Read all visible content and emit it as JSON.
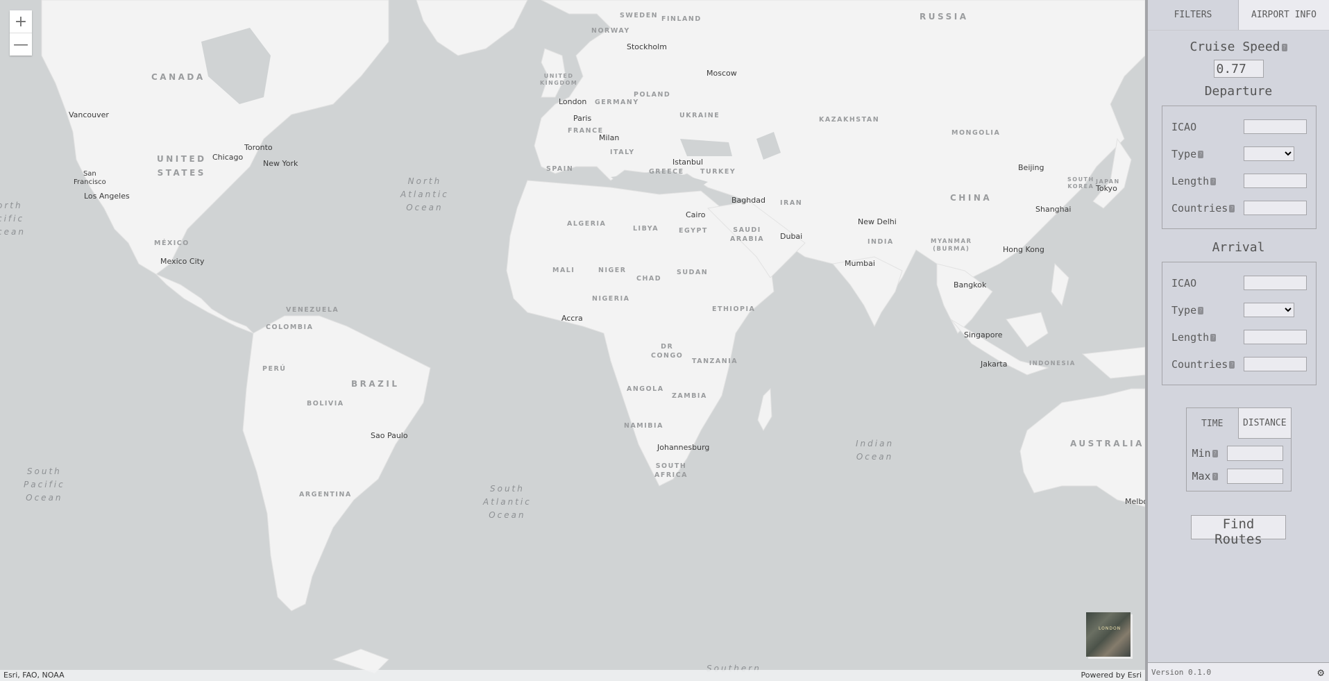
{
  "map": {
    "zoom_in": "+",
    "zoom_out": "—",
    "attribution_left": "Esri, FAO, NOAA",
    "attribution_right": "Powered by Esri",
    "basemap_thumb_label": "LONDON",
    "cities": [
      {
        "name": "Vancouver"
      },
      {
        "name": "San\nFrancisco"
      },
      {
        "name": "Los Angeles"
      },
      {
        "name": "Chicago"
      },
      {
        "name": "Toronto"
      },
      {
        "name": "New York"
      },
      {
        "name": "Mexico City"
      },
      {
        "name": "Sao Paulo"
      },
      {
        "name": "London"
      },
      {
        "name": "Paris"
      },
      {
        "name": "Milan"
      },
      {
        "name": "Stockholm"
      },
      {
        "name": "Moscow"
      },
      {
        "name": "Istanbul"
      },
      {
        "name": "Cairo"
      },
      {
        "name": "Baghdad"
      },
      {
        "name": "Dubai"
      },
      {
        "name": "Accra"
      },
      {
        "name": "Johannesburg"
      },
      {
        "name": "New Delhi"
      },
      {
        "name": "Mumbai"
      },
      {
        "name": "Beijing"
      },
      {
        "name": "Shanghai"
      },
      {
        "name": "Hong Kong"
      },
      {
        "name": "Tokyo"
      },
      {
        "name": "Bangkok"
      },
      {
        "name": "Singapore"
      },
      {
        "name": "Jakarta"
      },
      {
        "name": "Melbo"
      }
    ],
    "countries": [
      {
        "name": "CANADA"
      },
      {
        "name": "UNITED\nSTATES"
      },
      {
        "name": "MÉXICO"
      },
      {
        "name": "VENEZUELA"
      },
      {
        "name": "COLOMBIA"
      },
      {
        "name": "PERÚ"
      },
      {
        "name": "BRAZIL"
      },
      {
        "name": "BOLIVIA"
      },
      {
        "name": "ARGENTINA"
      },
      {
        "name": "SWEDEN"
      },
      {
        "name": "FINLAND"
      },
      {
        "name": "NORWAY"
      },
      {
        "name": "UNITED\nKINGDOM"
      },
      {
        "name": "GERMANY"
      },
      {
        "name": "POLAND"
      },
      {
        "name": "FRANCE"
      },
      {
        "name": "UKRAINE"
      },
      {
        "name": "ITALY"
      },
      {
        "name": "SPAIN"
      },
      {
        "name": "GREECE"
      },
      {
        "name": "TURKEY"
      },
      {
        "name": "RUSSIA"
      },
      {
        "name": "KAZAKHSTAN"
      },
      {
        "name": "MONGOLIA"
      },
      {
        "name": "CHINA"
      },
      {
        "name": "IRAN"
      },
      {
        "name": "SAUDI\nARABIA"
      },
      {
        "name": "EGYPT"
      },
      {
        "name": "LIBYA"
      },
      {
        "name": "ALGERIA"
      },
      {
        "name": "MALI"
      },
      {
        "name": "NIGER"
      },
      {
        "name": "CHAD"
      },
      {
        "name": "SUDAN"
      },
      {
        "name": "NIGERIA"
      },
      {
        "name": "ETHIOPIA"
      },
      {
        "name": "DR\nCONGO"
      },
      {
        "name": "TANZANIA"
      },
      {
        "name": "ANGOLA"
      },
      {
        "name": "ZAMBIA"
      },
      {
        "name": "NAMIBIA"
      },
      {
        "name": "SOUTH\nAFRICA"
      },
      {
        "name": "INDIA"
      },
      {
        "name": "MYANMAR\n(BURMA)"
      },
      {
        "name": "SOUTH\nKOREA"
      },
      {
        "name": "JAPAN"
      },
      {
        "name": "INDONESIA"
      },
      {
        "name": "AUSTRALIA"
      }
    ],
    "oceans": [
      {
        "name": "North\nAtlantic\nOcean"
      },
      {
        "name": "orth\ncific\ncean"
      },
      {
        "name": "South\nPacific\nOcean"
      },
      {
        "name": "South\nAtlantic\nOcean"
      },
      {
        "name": "Indian\nOcean"
      },
      {
        "name": "Southern"
      }
    ]
  },
  "panel": {
    "tabs": [
      {
        "label": "FILTERS",
        "active": true
      },
      {
        "label": "AIRPORT INFO",
        "active": false
      }
    ],
    "cruise_speed": {
      "label": "Cruise Speed",
      "value": "0.77"
    },
    "help_glyph": "?",
    "departure": {
      "title": "Departure",
      "fields": {
        "icao": "ICAO",
        "type": "Type",
        "length": "Length",
        "countries": "Countries"
      }
    },
    "arrival": {
      "title": "Arrival",
      "fields": {
        "icao": "ICAO",
        "type": "Type",
        "length": "Length",
        "countries": "Countries"
      }
    },
    "mode_tabs": [
      {
        "label": "TIME",
        "selected": false
      },
      {
        "label": "DISTANCE",
        "selected": true
      }
    ],
    "min_label": "Min",
    "max_label": "Max",
    "find_button": "Find Routes",
    "version": "Version 0.1.0",
    "settings_icon": "⚙"
  }
}
